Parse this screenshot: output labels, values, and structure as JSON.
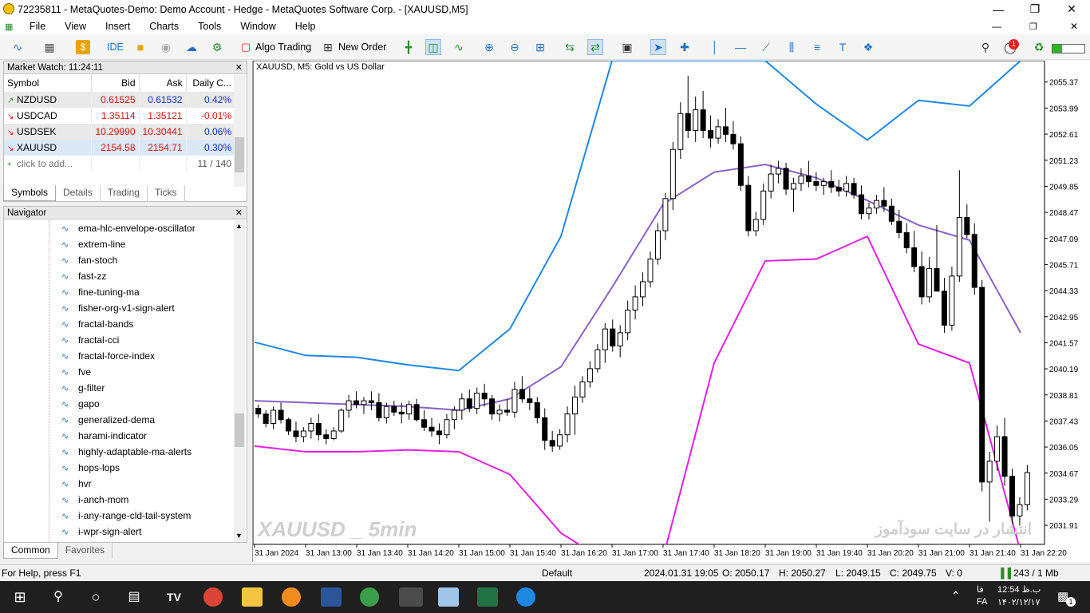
{
  "window": {
    "title": "72235811 - MetaQuotes-Demo: Demo Account - Hedge - MetaQuotes Software Corp. - [XAUUSD,M5]"
  },
  "menu": [
    "File",
    "View",
    "Insert",
    "Charts",
    "Tools",
    "Window",
    "Help"
  ],
  "toolbar": {
    "ide": "IDE",
    "algo": "Algo Trading",
    "new_order": "New Order",
    "badge": "1"
  },
  "market_watch": {
    "title": "Market Watch: 11:24:11",
    "headers": [
      "Symbol",
      "Bid",
      "Ask",
      "Daily C..."
    ],
    "rows": [
      {
        "symbol": "NZDUSD",
        "bid": "0.61525",
        "ask": "0.61532",
        "change": "0.42%",
        "dir": "up"
      },
      {
        "symbol": "USDCAD",
        "bid": "1.35114",
        "ask": "1.35121",
        "change": "-0.01%",
        "dir": "down"
      },
      {
        "symbol": "USDSEK",
        "bid": "10.29990",
        "ask": "10.30441",
        "change": "0.06%",
        "dir": "down"
      },
      {
        "symbol": "XAUUSD",
        "bid": "2154.58",
        "ask": "2154.71",
        "change": "0.30%",
        "dir": "down"
      }
    ],
    "add": "click to add...",
    "count": "11 / 140",
    "tabs": [
      "Symbols",
      "Details",
      "Trading",
      "Ticks"
    ]
  },
  "navigator": {
    "title": "Navigator",
    "items": [
      "ema-hlc-envelope-oscillator",
      "extrem-line",
      "fan-stoch",
      "fast-zz",
      "fine-tuning-ma",
      "fisher-org-v1-sign-alert",
      "fractal-bands",
      "fractal-cci",
      "fractal-force-index",
      "fve",
      "g-filter",
      "gapo",
      "generalized-dema",
      "harami-indicator",
      "highly-adaptable-ma-alerts",
      "hops-lops",
      "hvr",
      "i-anch-mom",
      "i-any-range-cld-tail-system",
      "i-wpr-sign-alert"
    ],
    "tabs": [
      "Common",
      "Favorites"
    ]
  },
  "chart": {
    "header": "XAUUSD, M5:  Gold vs US Dollar",
    "watermark_left": "XAUUSD _ 5min",
    "watermark_right": "انتشار در سایت سودآموز",
    "price_labels": [
      "2055.37",
      "2053.99",
      "2052.61",
      "2051.23",
      "2049.85",
      "2048.47",
      "2047.09",
      "2045.71",
      "2044.33",
      "2042.95",
      "2041.57",
      "2040.19",
      "2038.81",
      "2037.43",
      "2036.05",
      "2034.67",
      "2033.29",
      "2031.91"
    ],
    "time_labels": [
      "31 Jan 2024",
      "31 Jan 13:00",
      "31 Jan 13:40",
      "31 Jan 14:20",
      "31 Jan 15:00",
      "31 Jan 15:40",
      "31 Jan 16:20",
      "31 Jan 17:00",
      "31 Jan 17:40",
      "31 Jan 18:20",
      "31 Jan 19:00",
      "31 Jan 19:40",
      "31 Jan 20:20",
      "31 Jan 21:00",
      "31 Jan 21:40",
      "31 Jan 22:20"
    ],
    "colors": {
      "upper": "#1e88e5",
      "middle": "#8a62c8",
      "lower": "#e61ee6"
    }
  },
  "chart_data": {
    "type": "line",
    "title": "XAUUSD, M5:  Gold vs US Dollar",
    "ylim": [
      2030.9,
      2056.5
    ],
    "x": [
      "31 Jan 2024",
      "31 Jan 13:00",
      "31 Jan 13:40",
      "31 Jan 14:20",
      "31 Jan 15:00",
      "31 Jan 15:40",
      "31 Jan 16:20",
      "31 Jan 17:00",
      "31 Jan 17:40",
      "31 Jan 18:20",
      "31 Jan 19:00",
      "31 Jan 19:40",
      "31 Jan 20:20",
      "31 Jan 21:00",
      "31 Jan 21:40",
      "31 Jan 22:20"
    ],
    "series": [
      {
        "values": [
          2041.6,
          2040.9,
          2040.8,
          2040.4,
          2040.1,
          2042.3,
          2047.2,
          2056.5,
          2056.5,
          2056.5,
          2056.5,
          2054.2,
          2052.3,
          2054.4,
          2054.1,
          2056.5
        ]
      },
      {
        "values": [
          2038.5,
          2038.4,
          2038.3,
          2038.2,
          2038.0,
          2038.6,
          2040.3,
          2044.5,
          2048.9,
          2050.6,
          2051.0,
          2050.3,
          2049.1,
          2047.8,
          2047.0,
          2042.1
        ]
      },
      {
        "values": [
          2036.1,
          2035.8,
          2035.8,
          2035.9,
          2035.8,
          2034.6,
          2031.5,
          2029.8,
          2030.2,
          2040.5,
          2045.9,
          2046.0,
          2047.2,
          2041.5,
          2040.5,
          2030.5
        ]
      }
    ],
    "candles": [
      [
        2038.1,
        2038.3,
        2037.6,
        2037.8
      ],
      [
        2037.8,
        2038.0,
        2037.1,
        2037.3
      ],
      [
        2037.3,
        2038.2,
        2037.0,
        2038.0
      ],
      [
        2038.0,
        2038.4,
        2037.3,
        2037.5
      ],
      [
        2037.5,
        2037.6,
        2036.7,
        2036.9
      ],
      [
        2036.9,
        2037.4,
        2036.3,
        2036.6
      ],
      [
        2036.6,
        2037.1,
        2036.3,
        2036.9
      ],
      [
        2036.9,
        2037.6,
        2036.5,
        2037.3
      ],
      [
        2037.3,
        2037.8,
        2036.4,
        2036.7
      ],
      [
        2036.7,
        2037.0,
        2036.2,
        2036.5
      ],
      [
        2036.5,
        2037.1,
        2036.4,
        2036.9
      ],
      [
        2036.9,
        2038.1,
        2036.8,
        2038.0
      ],
      [
        2038.0,
        2038.8,
        2037.6,
        2038.5
      ],
      [
        2038.5,
        2039.0,
        2038.1,
        2038.3
      ],
      [
        2038.3,
        2038.7,
        2037.8,
        2038.5
      ],
      [
        2038.5,
        2039.0,
        2038.0,
        2038.4
      ],
      [
        2038.4,
        2038.9,
        2037.4,
        2037.6
      ],
      [
        2037.6,
        2038.4,
        2037.3,
        2038.2
      ],
      [
        2038.2,
        2038.5,
        2037.7,
        2037.9
      ],
      [
        2037.9,
        2038.4,
        2037.3,
        2037.8
      ],
      [
        2037.8,
        2038.5,
        2037.5,
        2038.3
      ],
      [
        2038.3,
        2038.6,
        2037.4,
        2037.5
      ],
      [
        2037.5,
        2038.0,
        2036.9,
        2037.1
      ],
      [
        2037.1,
        2037.6,
        2036.6,
        2036.9
      ],
      [
        2036.9,
        2037.3,
        2036.2,
        2036.7
      ],
      [
        2036.7,
        2037.8,
        2036.5,
        2037.5
      ],
      [
        2037.5,
        2038.2,
        2037.0,
        2038.0
      ],
      [
        2038.0,
        2038.9,
        2037.5,
        2038.6
      ],
      [
        2038.6,
        2039.1,
        2037.9,
        2038.1
      ],
      [
        2038.1,
        2039.2,
        2037.8,
        2038.9
      ],
      [
        2038.9,
        2039.4,
        2038.2,
        2038.6
      ],
      [
        2038.6,
        2038.8,
        2037.5,
        2037.8
      ],
      [
        2037.8,
        2038.3,
        2037.4,
        2038.0
      ],
      [
        2038.0,
        2038.6,
        2037.7,
        2037.9
      ],
      [
        2037.9,
        2039.5,
        2037.6,
        2039.1
      ],
      [
        2039.1,
        2039.8,
        2038.4,
        2038.6
      ],
      [
        2038.6,
        2039.2,
        2038.0,
        2038.4
      ],
      [
        2038.4,
        2038.7,
        2037.3,
        2037.6
      ],
      [
        2037.6,
        2038.1,
        2035.9,
        2036.4
      ],
      [
        2036.4,
        2036.9,
        2035.8,
        2036.1
      ],
      [
        2036.1,
        2037.0,
        2035.9,
        2036.7
      ],
      [
        2036.7,
        2038.2,
        2036.3,
        2037.8
      ],
      [
        2037.8,
        2039.3,
        2036.7,
        2038.7
      ],
      [
        2038.7,
        2039.8,
        2038.4,
        2039.5
      ],
      [
        2039.5,
        2040.6,
        2039.2,
        2040.2
      ],
      [
        2040.2,
        2041.5,
        2040.0,
        2041.2
      ],
      [
        2041.2,
        2042.6,
        2040.5,
        2042.3
      ],
      [
        2042.3,
        2042.8,
        2041.1,
        2041.4
      ],
      [
        2041.4,
        2042.5,
        2040.8,
        2042.1
      ],
      [
        2042.1,
        2043.8,
        2041.7,
        2043.3
      ],
      [
        2043.3,
        2044.6,
        2042.8,
        2044.0
      ],
      [
        2044.0,
        2045.3,
        2043.5,
        2044.8
      ],
      [
        2044.8,
        2046.4,
        2044.5,
        2046.0
      ],
      [
        2046.0,
        2047.9,
        2045.7,
        2047.5
      ],
      [
        2047.5,
        2049.5,
        2047.0,
        2049.2
      ],
      [
        2049.2,
        2052.2,
        2048.6,
        2051.8
      ],
      [
        2051.8,
        2054.3,
        2051.3,
        2053.7
      ],
      [
        2053.7,
        2055.7,
        2052.4,
        2052.8
      ],
      [
        2052.8,
        2054.6,
        2052.2,
        2053.9
      ],
      [
        2053.9,
        2054.9,
        2052.4,
        2052.8
      ],
      [
        2052.8,
        2053.6,
        2051.9,
        2052.4
      ],
      [
        2052.4,
        2053.4,
        2052.1,
        2053.0
      ],
      [
        2053.0,
        2054.0,
        2052.2,
        2052.6
      ],
      [
        2052.6,
        2053.3,
        2051.8,
        2052.1
      ],
      [
        2052.1,
        2052.5,
        2049.6,
        2049.9
      ],
      [
        2049.9,
        2050.4,
        2047.2,
        2047.5
      ],
      [
        2047.5,
        2048.5,
        2047.2,
        2048.1
      ],
      [
        2048.1,
        2050.0,
        2047.8,
        2049.6
      ],
      [
        2049.6,
        2051.0,
        2049.2,
        2050.5
      ],
      [
        2050.5,
        2051.2,
        2050.0,
        2050.8
      ],
      [
        2050.8,
        2051.1,
        2049.4,
        2049.7
      ],
      [
        2049.7,
        2050.3,
        2048.5,
        2050.0
      ],
      [
        2050.0,
        2050.8,
        2049.6,
        2050.4
      ],
      [
        2050.4,
        2051.2,
        2049.8,
        2050.1
      ],
      [
        2050.1,
        2050.6,
        2049.6,
        2049.9
      ],
      [
        2049.9,
        2050.3,
        2049.4,
        2050.1
      ],
      [
        2050.1,
        2050.7,
        2049.5,
        2049.8
      ],
      [
        2049.8,
        2050.2,
        2049.3,
        2049.6
      ],
      [
        2049.6,
        2050.4,
        2049.3,
        2050.0
      ],
      [
        2050.0,
        2050.3,
        2049.2,
        2049.4
      ],
      [
        2049.4,
        2049.9,
        2048.1,
        2048.4
      ],
      [
        2048.4,
        2049.0,
        2048.1,
        2048.7
      ],
      [
        2048.7,
        2049.4,
        2048.4,
        2049.1
      ],
      [
        2049.1,
        2049.8,
        2048.5,
        2048.8
      ],
      [
        2048.8,
        2049.2,
        2047.8,
        2048.0
      ],
      [
        2048.0,
        2048.6,
        2047.1,
        2047.4
      ],
      [
        2047.4,
        2047.9,
        2046.3,
        2046.6
      ],
      [
        2046.6,
        2047.5,
        2045.3,
        2045.6
      ],
      [
        2045.6,
        2046.4,
        2043.6,
        2044.0
      ],
      [
        2044.0,
        2046.1,
        2043.7,
        2045.5
      ],
      [
        2045.5,
        2047.8,
        2044.9,
        2044.3
      ],
      [
        2044.3,
        2045.0,
        2042.1,
        2042.5
      ],
      [
        2042.5,
        2045.6,
        2042.2,
        2045.1
      ],
      [
        2045.1,
        2050.7,
        2044.8,
        2048.2
      ],
      [
        2048.2,
        2048.9,
        2047.1,
        2047.3
      ],
      [
        2047.3,
        2047.9,
        2044.1,
        2044.5
      ],
      [
        2044.5,
        2044.9,
        2033.7,
        2034.2
      ],
      [
        2034.2,
        2035.8,
        2032.1,
        2035.3
      ],
      [
        2035.3,
        2037.2,
        2034.8,
        2036.6
      ],
      [
        2036.6,
        2037.6,
        2034.0,
        2034.5
      ],
      [
        2034.5,
        2034.9,
        2032.0,
        2032.4
      ],
      [
        2032.4,
        2033.4,
        2031.9,
        2033.0
      ],
      [
        2033.0,
        2035.1,
        2032.7,
        2034.7
      ]
    ]
  },
  "status": {
    "help": "For Help, press F1",
    "profile": "Default",
    "datetime": "2024.01.31 19:05",
    "open": "O: 2050.17",
    "high": "H: 2050.27",
    "low": "L: 2049.15",
    "close": "C: 2049.75",
    "volume": "V: 0",
    "traffic": "243 / 1 Mb"
  },
  "taskbar": {
    "time": "12:54 ب.ظ",
    "date": "۱۴۰۲/۱۲/۱۷",
    "lang": "FA",
    "lang2": "فا",
    "notif": "1"
  }
}
